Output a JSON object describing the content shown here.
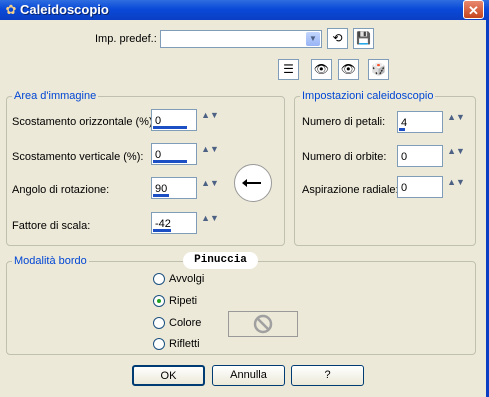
{
  "window": {
    "title": "Caleidoscopio",
    "close_glyph": "✕"
  },
  "preset": {
    "label": "Imp. predef.:",
    "value": ""
  },
  "icons": {
    "preset_reset": "⟲",
    "preset_save": "💾",
    "toolbar_1": "☰",
    "toolbar_2": "👁",
    "toolbar_3": "👁",
    "toolbar_4": "🎲"
  },
  "image_area": {
    "title": "Area d'immagine",
    "fields": [
      {
        "label": "Scostamento orizzontale (%):",
        "value": "0"
      },
      {
        "label": "Scostamento verticale (%):",
        "value": "0"
      },
      {
        "label": "Angolo di rotazione:",
        "value": "90"
      },
      {
        "label": "Fattore di scala:",
        "value": "-42"
      }
    ]
  },
  "kaleido_settings": {
    "title": "Impostazioni caleidoscopio",
    "fields": [
      {
        "label": "Numero di petali:",
        "value": "4"
      },
      {
        "label": "Numero di orbite:",
        "value": "0"
      },
      {
        "label": "Aspirazione radiale:",
        "value": "0"
      }
    ]
  },
  "edge_mode": {
    "title": "Modalità bordo",
    "options": [
      "Avvolgi",
      "Ripeti",
      "Colore",
      "Rifletti"
    ],
    "selected": "Ripeti"
  },
  "watermark": "Pinuccia",
  "buttons": {
    "ok": "OK",
    "cancel": "Annulla",
    "help": "?"
  }
}
